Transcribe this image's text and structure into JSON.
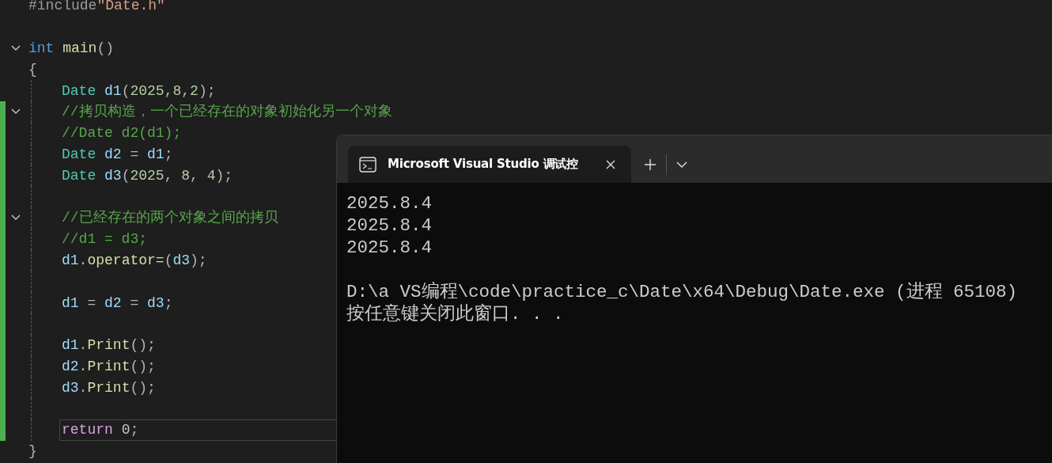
{
  "editor": {
    "lines": [
      {
        "kind": "code",
        "tokens": [
          {
            "kind": "preprocessor",
            "text": "#include"
          },
          {
            "kind": "string",
            "text": "\"Date.h\""
          }
        ]
      },
      {
        "kind": "blank"
      },
      {
        "kind": "code",
        "expanded": true,
        "tokens": [
          {
            "kind": "keyword",
            "text": "int "
          },
          {
            "kind": "function",
            "text": "main"
          },
          {
            "kind": "punct",
            "text": "()"
          }
        ]
      },
      {
        "kind": "code",
        "tokens": [
          {
            "kind": "punct",
            "text": "{"
          }
        ]
      },
      {
        "kind": "block",
        "children": [
          {
            "kind": "code",
            "tokens": [
              {
                "kind": "type",
                "text": "Date "
              },
              {
                "kind": "variable",
                "text": "d1"
              },
              {
                "kind": "punct",
                "text": "("
              },
              {
                "kind": "number",
                "text": "2025"
              },
              {
                "kind": "punct",
                "text": ","
              },
              {
                "kind": "number",
                "text": "8"
              },
              {
                "kind": "punct",
                "text": ","
              },
              {
                "kind": "number",
                "text": "2"
              },
              {
                "kind": "punct",
                "text": ");"
              }
            ]
          },
          {
            "kind": "code",
            "modified": true,
            "expanded": true,
            "tokens": [
              {
                "kind": "comment",
                "text": "//拷贝构造，一个已经存在的对象初始化另一个对象"
              }
            ]
          },
          {
            "kind": "code",
            "modified": true,
            "tokens": [
              {
                "kind": "comment",
                "text": "//Date d2(d1);"
              }
            ]
          },
          {
            "kind": "code",
            "modified": true,
            "tokens": [
              {
                "kind": "type",
                "text": "Date "
              },
              {
                "kind": "variable",
                "text": "d2"
              },
              {
                "kind": "punct",
                "text": " = "
              },
              {
                "kind": "variable",
                "text": "d1"
              },
              {
                "kind": "punct",
                "text": ";"
              }
            ]
          },
          {
            "kind": "code",
            "modified": true,
            "tokens": [
              {
                "kind": "type",
                "text": "Date "
              },
              {
                "kind": "variable",
                "text": "d3"
              },
              {
                "kind": "punct",
                "text": "("
              },
              {
                "kind": "number",
                "text": "2025"
              },
              {
                "kind": "punct",
                "text": ", "
              },
              {
                "kind": "number",
                "text": "8"
              },
              {
                "kind": "punct",
                "text": ", "
              },
              {
                "kind": "number",
                "text": "4"
              },
              {
                "kind": "punct",
                "text": ");"
              }
            ]
          },
          {
            "kind": "blank",
            "modified": true
          },
          {
            "kind": "code",
            "modified": true,
            "expanded": true,
            "tokens": [
              {
                "kind": "comment",
                "text": "//已经存在的两个对象之间的拷贝"
              }
            ]
          },
          {
            "kind": "code",
            "modified": true,
            "tokens": [
              {
                "kind": "comment",
                "text": "//d1 = d3;"
              }
            ]
          },
          {
            "kind": "code",
            "modified": true,
            "tokens": [
              {
                "kind": "variable",
                "text": "d1"
              },
              {
                "kind": "punct",
                "text": "."
              },
              {
                "kind": "function",
                "text": "operator="
              },
              {
                "kind": "punct",
                "text": "("
              },
              {
                "kind": "variable",
                "text": "d3"
              },
              {
                "kind": "punct",
                "text": ");"
              }
            ]
          },
          {
            "kind": "blank",
            "modified": true
          },
          {
            "kind": "code",
            "modified": true,
            "tokens": [
              {
                "kind": "variable",
                "text": "d1"
              },
              {
                "kind": "punct",
                "text": " = "
              },
              {
                "kind": "variable",
                "text": "d2"
              },
              {
                "kind": "punct",
                "text": " = "
              },
              {
                "kind": "variable",
                "text": "d3"
              },
              {
                "kind": "punct",
                "text": ";"
              }
            ]
          },
          {
            "kind": "blank",
            "modified": true
          },
          {
            "kind": "code",
            "modified": true,
            "tokens": [
              {
                "kind": "variable",
                "text": "d1"
              },
              {
                "kind": "punct",
                "text": "."
              },
              {
                "kind": "function",
                "text": "Print"
              },
              {
                "kind": "punct",
                "text": "();"
              }
            ]
          },
          {
            "kind": "code",
            "modified": true,
            "tokens": [
              {
                "kind": "variable",
                "text": "d2"
              },
              {
                "kind": "punct",
                "text": "."
              },
              {
                "kind": "function",
                "text": "Print"
              },
              {
                "kind": "punct",
                "text": "();"
              }
            ]
          },
          {
            "kind": "code",
            "modified": true,
            "tokens": [
              {
                "kind": "variable",
                "text": "d3"
              },
              {
                "kind": "punct",
                "text": "."
              },
              {
                "kind": "function",
                "text": "Print"
              },
              {
                "kind": "punct",
                "text": "();"
              }
            ]
          },
          {
            "kind": "blank",
            "modified": true
          },
          {
            "kind": "code",
            "modified": true,
            "current": true,
            "tokens": [
              {
                "kind": "control",
                "text": "return "
              },
              {
                "kind": "number",
                "text": "0"
              },
              {
                "kind": "punct",
                "text": ";"
              }
            ]
          }
        ]
      },
      {
        "kind": "code",
        "tokens": [
          {
            "kind": "punct",
            "text": "}"
          }
        ]
      }
    ]
  },
  "terminal": {
    "tabs": [
      {
        "title": "Microsoft Visual Studio 调试控",
        "selected": true
      }
    ],
    "output": [
      {
        "kind": "text",
        "text": "2025.8.4"
      },
      {
        "kind": "text",
        "text": "2025.8.4"
      },
      {
        "kind": "text",
        "text": "2025.8.4"
      },
      {
        "kind": "blank"
      },
      {
        "kind": "text",
        "text": "D:\\a VS编程\\code\\practice_c\\Date\\x64\\Debug\\Date.exe (进程 65108)"
      },
      {
        "kind": "text",
        "text": "按任意键关闭此窗口. . ."
      }
    ]
  }
}
